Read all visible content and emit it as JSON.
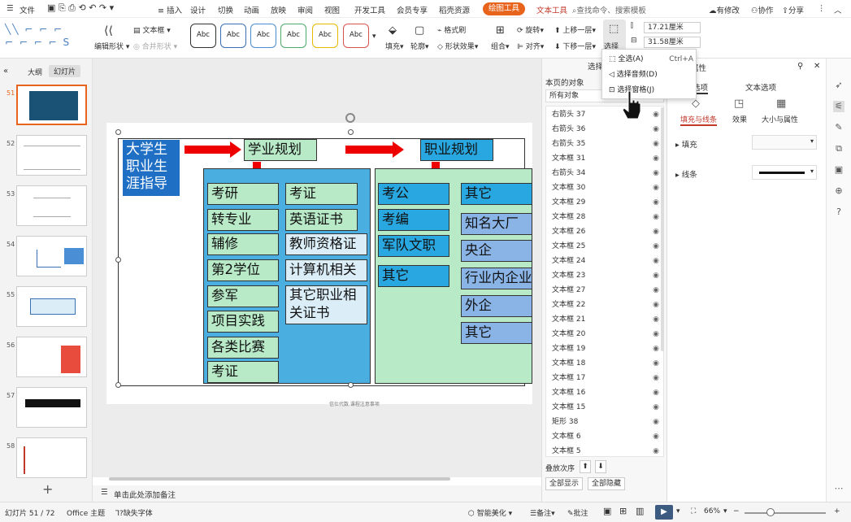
{
  "menu": {
    "file": "文件",
    "items": [
      "插入",
      "设计",
      "切换",
      "动画",
      "放映",
      "审阅",
      "视图",
      "开发工具",
      "会员专享",
      "稻壳资源"
    ],
    "draw_tool": "绘图工具",
    "text_tool": "文本工具",
    "search": "查找命令、搜索模板",
    "has_changes": "有修改",
    "collab": "协作",
    "share": "分享"
  },
  "ribbon": {
    "edit_shape": "编辑形状",
    "textbox": "文本框",
    "merge_shape": "合并形状",
    "shape_style_label": "Abc",
    "fill": "填充",
    "outline": "轮廓",
    "format_brush": "格式刷",
    "shape_effect": "形状效果",
    "group": "组合",
    "rotate": "旋转",
    "align": "对齐",
    "up_layer": "上移一层",
    "down_layer": "下移一层",
    "select": "选择",
    "height": "17.21厘米",
    "width": "31.58厘米"
  },
  "left_panel": {
    "tab_outline": "大纲",
    "tab_slides": "幻灯片",
    "slide_numbers": [
      "51",
      "52",
      "53",
      "54",
      "55",
      "56",
      "57",
      "58"
    ],
    "add": "+"
  },
  "slide": {
    "title": "大学生职业生涯指导",
    "title_lines": [
      "大学生",
      "职业生",
      "涯指导"
    ],
    "study_plan": "学业规划",
    "career_plan": "职业规划",
    "study_left": [
      "考研",
      "转专业",
      "辅修",
      "第2学位",
      "参军",
      "项目实践",
      "各类比赛",
      "考证"
    ],
    "study_right": [
      "考证",
      "英语证书",
      "教师资格证",
      "计算机相关",
      "其它职业相关证书"
    ],
    "study_right_last_lines": [
      "其它职业相",
      "关证书"
    ],
    "career_left": [
      "考公",
      "考编",
      "军队文职",
      "其它"
    ],
    "career_right": [
      "其它",
      "知名大厂",
      "央企",
      "行业内企业",
      "外企",
      "其它"
    ],
    "footer": "信仕代数 课程注意事项"
  },
  "notes": "单击此处添加备注",
  "select_panel": {
    "title": "选择",
    "objects_on_page": "本页的对象",
    "all_objects": "所有对象",
    "items": [
      "右箭头 37",
      "右箭头 36",
      "右箭头 35",
      "文本框 31",
      "右箭头 34",
      "文本框 30",
      "文本框 29",
      "文本框 28",
      "文本框 26",
      "文本框 25",
      "文本框 24",
      "文本框 23",
      "文本框 27",
      "文本框 22",
      "文本框 21",
      "文本框 20",
      "文本框 19",
      "文本框 18",
      "文本框 17",
      "文本框 16",
      "文本框 15",
      "矩形 38",
      "文本框 6",
      "文本框 5"
    ],
    "order_label": "叠放次序",
    "show_all": "全部显示",
    "hide_all": "全部隐藏"
  },
  "select_popup": {
    "items": [
      "全选(A)",
      "选择音频(D)",
      "选择窗格(J)"
    ],
    "shortcut": "Ctrl+A"
  },
  "property_panel": {
    "title": "对象属性",
    "tab_shape": "形状选项",
    "tab_text": "文本选项",
    "sub_fill_line": "填充与线条",
    "sub_effect": "效果",
    "sub_size": "大小与属性",
    "fill": "填充",
    "line": "线条"
  },
  "status": {
    "slide_pos": "幻灯片 51 / 72",
    "theme": "Office 主题",
    "missing_font": "缺失字体",
    "smart_beautify": "智能美化",
    "notes": "备注",
    "comment": "批注",
    "zoom": "66%"
  }
}
